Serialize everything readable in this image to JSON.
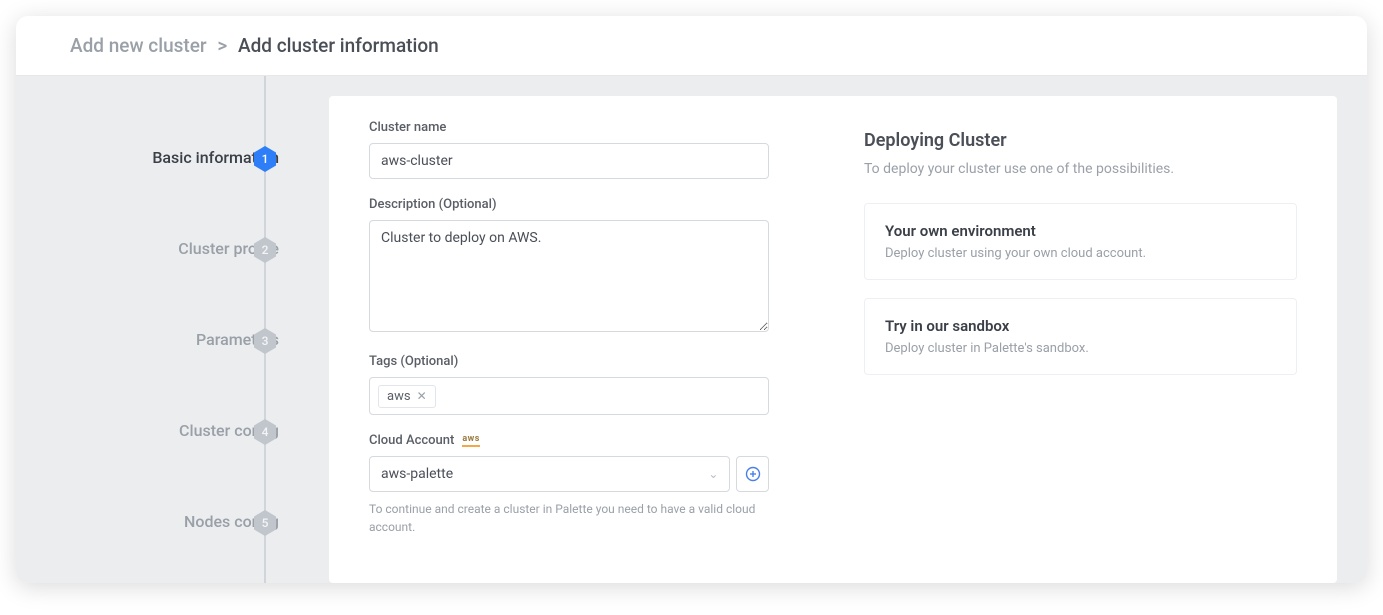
{
  "breadcrumb": {
    "parent": "Add new cluster",
    "sep": ">",
    "current": "Add cluster information"
  },
  "steps": [
    {
      "label": "Basic information",
      "num": "1"
    },
    {
      "label": "Cluster profile",
      "num": "2"
    },
    {
      "label": "Parameters",
      "num": "3"
    },
    {
      "label": "Cluster config",
      "num": "4"
    },
    {
      "label": "Nodes config",
      "num": "5"
    }
  ],
  "form": {
    "cluster_name_label": "Cluster name",
    "cluster_name_value": "aws-cluster",
    "description_label": "Description (Optional)",
    "description_value": "Cluster to deploy on AWS.",
    "tags_label": "Tags (Optional)",
    "tags": [
      {
        "text": "aws"
      }
    ],
    "cloud_account_label": "Cloud Account",
    "cloud_account_provider": "aws",
    "cloud_account_value": "aws-palette",
    "cloud_account_hint": "To continue and create a cluster in Palette you need to have a valid cloud account."
  },
  "side": {
    "title": "Deploying Cluster",
    "subtitle": "To deploy your cluster use one of the possibilities.",
    "options": [
      {
        "title": "Your own environment",
        "desc": "Deploy cluster using your own cloud account."
      },
      {
        "title": "Try in our sandbox",
        "desc": "Deploy cluster in Palette's sandbox."
      }
    ]
  }
}
